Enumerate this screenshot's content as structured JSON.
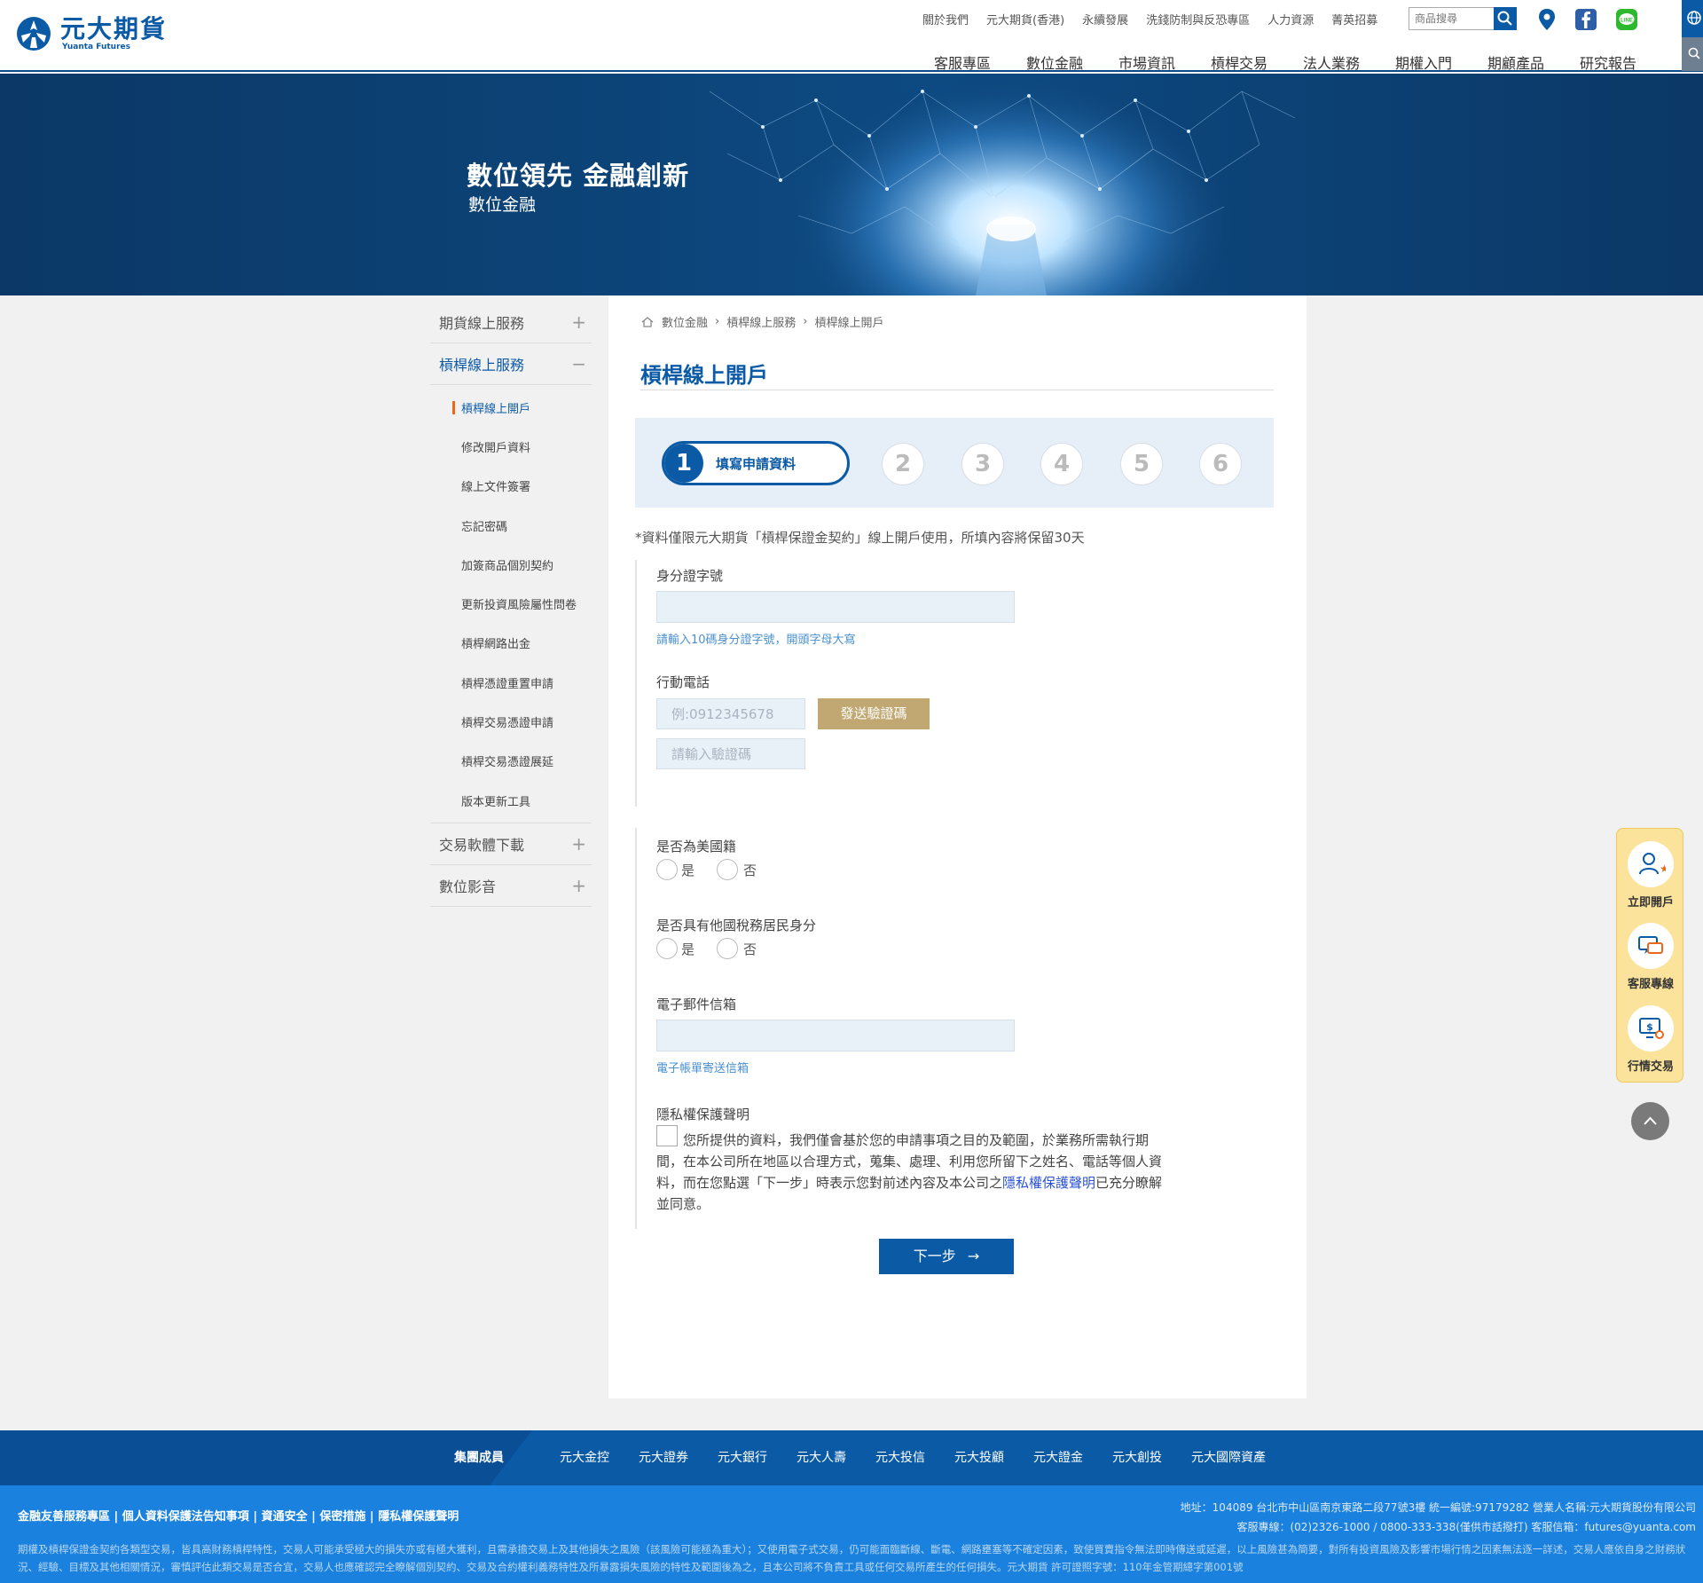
{
  "header": {
    "logo_cn": "元大期貨",
    "logo_en": "Yuanta Futures",
    "top_links": [
      "關於我們",
      "元大期貨(香港)",
      "永續發展",
      "洗錢防制與反恐專區",
      "人力資源",
      "菁英招募"
    ],
    "search_placeholder": "商品搜尋",
    "main_nav": [
      "客服專區",
      "數位金融",
      "市場資訊",
      "槓桿交易",
      "法人業務",
      "期權入門",
      "期顧產品",
      "研究報告"
    ]
  },
  "banner": {
    "title": "數位領先  金融創新",
    "subtitle": "數位金融"
  },
  "sidebar": {
    "groups": [
      {
        "label": "期貨線上服務",
        "sign": "+"
      },
      {
        "label": "槓桿線上服務",
        "sign": "−"
      },
      {
        "label": "交易軟體下載",
        "sign": "+"
      },
      {
        "label": "數位影音",
        "sign": "+"
      }
    ],
    "subitems": [
      "槓桿線上開戶",
      "修改開戶資料",
      "線上文件簽署",
      "忘記密碼",
      "加簽商品個別契約",
      "更新投資風險屬性問卷",
      "槓桿網路出金",
      "槓桿憑證重置申請",
      "槓桿交易憑證申請",
      "槓桿交易憑證展延",
      "版本更新工具"
    ]
  },
  "breadcrumb": [
    "數位金融",
    "槓桿線上服務",
    "槓桿線上開戶"
  ],
  "page_title": "槓桿線上開戶",
  "steps": {
    "current_num": "1",
    "current_label": "填寫申請資料",
    "others": [
      "2",
      "3",
      "4",
      "5",
      "6"
    ]
  },
  "note": "*資料僅限元大期貨「槓桿保證金契約」線上開戶使用，所填內容將保留30天",
  "form": {
    "id_label": "身分證字號",
    "id_hint": "請輸入10碼身分證字號，開頭字母大寫",
    "phone_label": "行動電話",
    "phone_placeholder": "例:0912345678",
    "send_code": "發送驗證碼",
    "code_placeholder": "請輸入驗證碼",
    "us_label": "是否為美國籍",
    "tax_label": "是否具有他國稅務居民身分",
    "yes": "是",
    "no": "否",
    "email_label": "電子郵件信箱",
    "email_hint": "電子帳單寄送信箱",
    "privacy_label": "隱私權保護聲明",
    "privacy_text": "您所提供的資料，我們僅會基於您的申請事項之目的及範圍，於業務所需執行期間，在本公司所在地區以合理方式，蒐集、處理、利用您所留下之姓名、電話等個人資料，而在您點選「下一步」時表示您對前述內容及本公司之",
    "privacy_link": "隱私權保護聲明",
    "privacy_tail": "已充分瞭解並同意。",
    "next": "下一步"
  },
  "float_widget": [
    "立即開戶",
    "客服專線",
    "行情交易"
  ],
  "footer": {
    "group_label": "集團成員",
    "members": [
      "元大金控",
      "元大證券",
      "元大銀行",
      "元大人壽",
      "元大投信",
      "元大投顧",
      "元大證金",
      "元大創投",
      "元大國際資產"
    ],
    "links": "金融友善服務專區 | 個人資料保護法告知事項 | 資通安全 | 保密措施 | 隱私權保護聲明",
    "address": "地址：104089 台北市中山區南京東路二段77號3樓   統一編號:97179282   營業人名稱:元大期貨股份有限公司",
    "contact": "客服專線：(02)2326-1000 / 0800-333-338(僅供市話撥打)   客服信箱：futures@yuanta.com",
    "disclaimer": "期權及槓桿保證金契約各類型交易，皆具高財務槓桿特性，交易人可能承受極大的損失亦或有極大獲利，且需承擔交易上及其他損失之風險（該風險可能極為重大）；又使用電子式交易，仍可能面臨斷線、斷電、網路壅塞等不確定因素，致使買賣指令無法即時傳送或延遲，以上風險甚為簡要，對所有投資風險及影響市場行情之因素無法逐一詳述，交易人應依自身之財務狀況、經驗、目標及其他相關情況，審慎評估此類交易是否合宜，交易人也應確認完全瞭解個別契約、交易及合約權利義務特性及所暴露損失風險的特性及範圍後為之，且本公司將不負責工具或任何交易所產生的任何損失。元大期貨 許可證照字號：110年金管期總字第001號"
  }
}
